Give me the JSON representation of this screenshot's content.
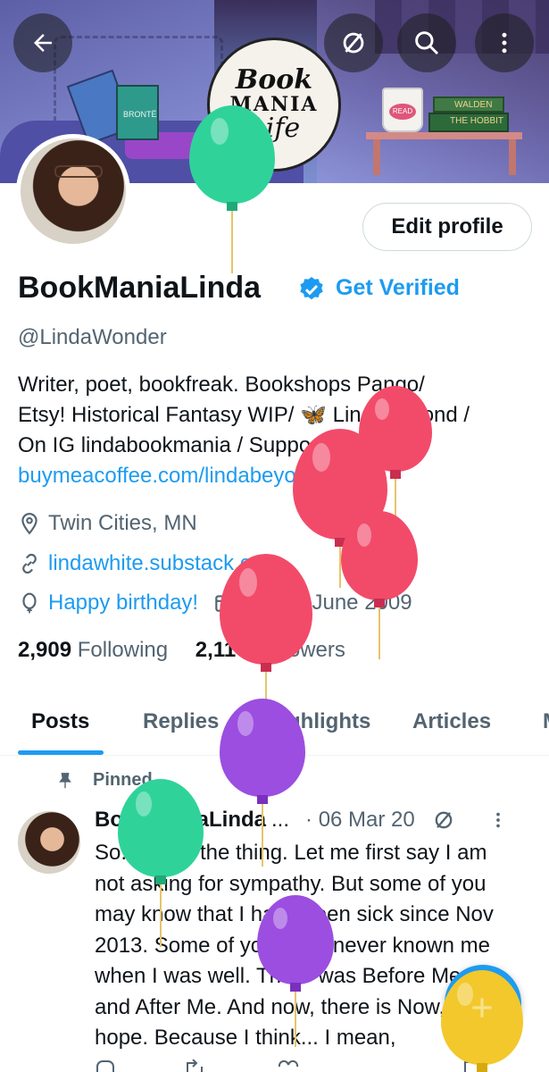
{
  "colors": {
    "accent": "#1d9bf0",
    "text_primary": "#0f1419",
    "text_secondary": "#536471",
    "balloon_green": "#2fd39a",
    "balloon_red": "#f24b6a",
    "balloon_purple": "#9b4ee0",
    "balloon_yellow": "#f2c82c"
  },
  "header": {
    "back_icon": "arrow-left-icon",
    "crypto_icon": "slashed-circle-icon",
    "search_icon": "search-icon",
    "more_icon": "more-vertical-icon",
    "banner_logo": {
      "line1": "Book",
      "line2": "MANIA",
      "line3": "Life"
    },
    "banner_book_green": "BRONTË",
    "banner_book_walden": "WALDEN",
    "banner_book_hobbit": "THE HOBBIT",
    "banner_mug": "READ"
  },
  "profile": {
    "edit_label": "Edit profile",
    "display_name": "BookManiaLinda",
    "get_verified": "Get Verified",
    "handle": "@LindaWonder",
    "bio_line1": "Writer, poet, bookfreak. Bookshops Pango/",
    "bio_line2": "Etsy! Historical Fantasy WIP/ 🦋 LindaBeyond /",
    "bio_line3": "On IG lindabookmania / Support me on",
    "bio_link": "buymeacoffee.com/lindabeyon",
    "location": "Twin Cities, MN",
    "website": "lindawhite.substack.com",
    "birthday": "Happy birthday!",
    "joined": "Joined June 2009",
    "following_count": "2,909",
    "following_label": "Following",
    "followers_count": "2,114",
    "followers_label": "Followers"
  },
  "tabs": [
    {
      "label": "Posts",
      "active": true
    },
    {
      "label": "Replies"
    },
    {
      "label": "Highlights"
    },
    {
      "label": "Articles"
    },
    {
      "label": "M"
    }
  ],
  "pinned_post": {
    "pinned_label": "Pinned",
    "author": "BookManiaLinda",
    "ellipsis": "...",
    "date": "· 06 Mar 20",
    "text_lines": [
      "So. Here's the thing. Let me first say I am",
      "not asking for sympathy. But some of you",
      "may know that I have been sick since Nov",
      "2013. Some of you have never known me",
      "when I was well. There was Before Me",
      "and After Me. And now, there is Now, I",
      "hope. Because I think... I mean,"
    ]
  },
  "fab": {
    "icon": "plus-icon"
  }
}
